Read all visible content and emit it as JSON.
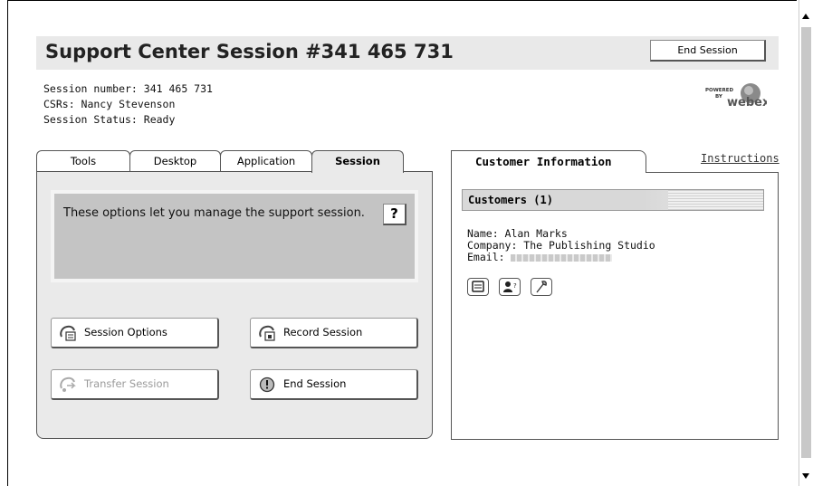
{
  "header": {
    "title": "Support Center Session #341 465 731",
    "end_session_label": "End Session"
  },
  "session_info": {
    "number": "Session number: 341 465 731",
    "csrs": "CSRs: Nancy Stevenson",
    "status": "Session Status: Ready"
  },
  "logo": {
    "powered": "POWERED",
    "by": "BY",
    "brand": "webex"
  },
  "left_tabs": [
    {
      "label": "Tools",
      "active": false
    },
    {
      "label": "Desktop",
      "active": false
    },
    {
      "label": "Application",
      "active": false
    },
    {
      "label": "Session",
      "active": true
    }
  ],
  "session_panel": {
    "description": "These options let you manage the support session.",
    "help_label": "?",
    "buttons": {
      "session_options": "Session Options",
      "record_session": "Record Session",
      "transfer_session": "Transfer Session",
      "end_session": "End Session"
    }
  },
  "right_panel": {
    "tab_label": "Customer Information",
    "instructions_label": "Instructions",
    "customers_header": "Customers (1)",
    "name": "Name: Alan Marks",
    "company": "Company: The Publishing Studio",
    "email_label": "Email:"
  },
  "icons": {
    "session_options": "gear-phone-icon",
    "record_session": "record-icon",
    "transfer_session": "transfer-icon",
    "end_session": "stop-icon",
    "customer_icons": [
      "computer-icon",
      "user-info-icon",
      "wrench-icon"
    ]
  },
  "colors": {
    "title_bg": "#e9e9e9",
    "panel_bg": "#eaeaea",
    "desc_bg": "#c4c4c4",
    "disabled_text": "#9a9a9a"
  }
}
